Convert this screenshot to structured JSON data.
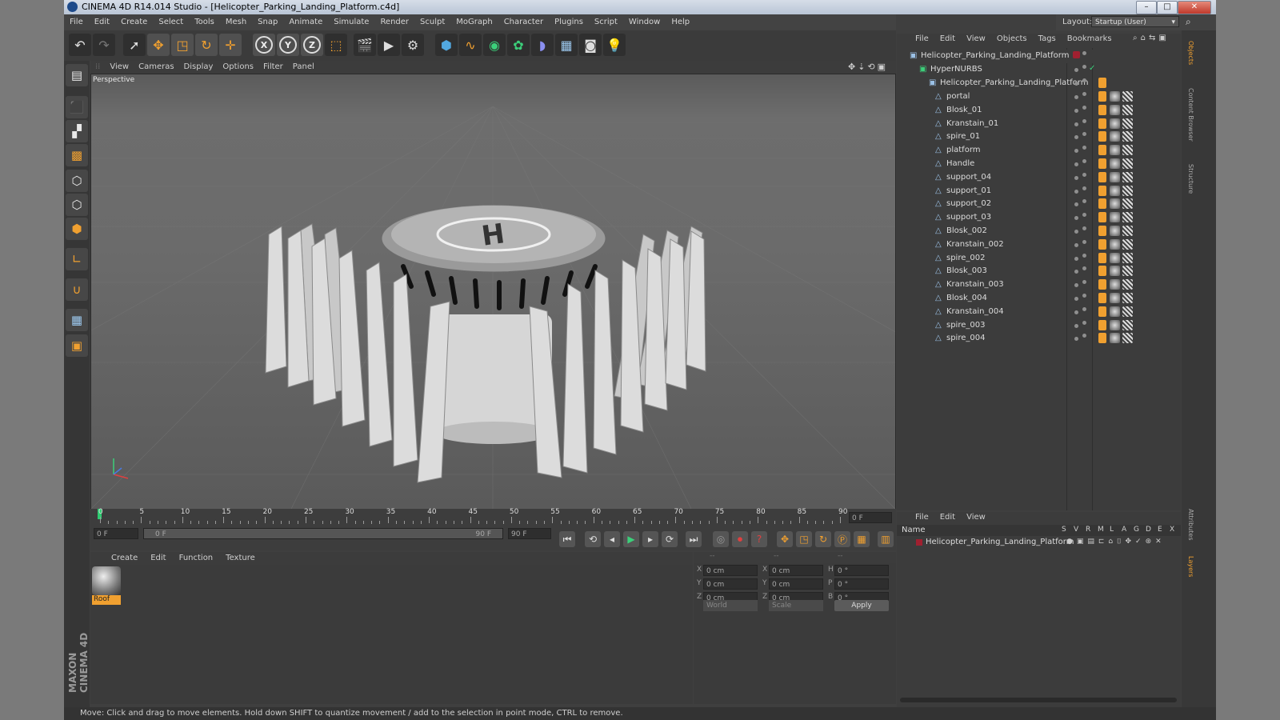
{
  "window": {
    "title": "CINEMA 4D R14.014 Studio - [Helicopter_Parking_Landing_Platform.c4d]",
    "controls": [
      "–",
      "□",
      "✕"
    ]
  },
  "menu": [
    "File",
    "Edit",
    "Create",
    "Select",
    "Tools",
    "Mesh",
    "Snap",
    "Animate",
    "Simulate",
    "Render",
    "Sculpt",
    "MoGraph",
    "Character",
    "Plugins",
    "Script",
    "Window",
    "Help"
  ],
  "layout": {
    "label": "Layout:",
    "value": "Startup (User)"
  },
  "toolbar": {
    "icons": [
      "undo-icon",
      "redo-icon",
      "select-arrow-icon",
      "move-icon",
      "scale-icon",
      "rotate-icon",
      "live-select-icon",
      "x-axis-icon",
      "y-axis-icon",
      "z-axis-icon",
      "coord-system-icon",
      "render-view-icon",
      "render-picture-icon",
      "render-settings-icon",
      "cube-icon",
      "spline-icon",
      "nurbs-icon",
      "array-icon",
      "deformer-icon",
      "floor-icon",
      "camera-icon",
      "light-icon"
    ],
    "axis_labels": [
      "X",
      "Y",
      "Z"
    ]
  },
  "viewport": {
    "menu": [
      "View",
      "Cameras",
      "Display",
      "Options",
      "Filter",
      "Panel"
    ],
    "label": "Perspective",
    "helipad_letter": "H"
  },
  "timeline": {
    "ticks": [
      "0",
      "5",
      "10",
      "15",
      "20",
      "25",
      "30",
      "35",
      "40",
      "45",
      "50",
      "55",
      "60",
      "65",
      "70",
      "75",
      "80",
      "85",
      "90"
    ],
    "current_frame": "0 F"
  },
  "transport": {
    "start": "0 F",
    "range_start": "0 F",
    "range_end": "90 F",
    "end": "90 F"
  },
  "materials": {
    "menu": [
      "Create",
      "Edit",
      "Function",
      "Texture"
    ],
    "items": [
      {
        "name": "Roof"
      }
    ]
  },
  "coords": {
    "header": [
      "--",
      "--",
      "--"
    ],
    "rows": [
      {
        "a": "X",
        "av": "0 cm",
        "b": "X",
        "bv": "0 cm",
        "c": "H",
        "cv": "0 °"
      },
      {
        "a": "Y",
        "av": "0 cm",
        "b": "Y",
        "bv": "0 cm",
        "c": "P",
        "cv": "0 °"
      },
      {
        "a": "Z",
        "av": "0 cm",
        "b": "Z",
        "bv": "0 cm",
        "c": "B",
        "cv": "0 °"
      }
    ],
    "world": "World",
    "scale": "Scale",
    "apply": "Apply"
  },
  "objects": {
    "menu": [
      "File",
      "Edit",
      "View",
      "Objects",
      "Tags",
      "Bookmarks"
    ],
    "root": "Helicopter_Parking_Landing_Platform",
    "hypernurbs": "HyperNURBS",
    "group": "Helicopter_Parking_Landing_Platform",
    "children": [
      "portal",
      "Blosk_01",
      "Kranstain_01",
      "spire_01",
      "platform",
      "Handle",
      "support_04",
      "support_01",
      "support_02",
      "support_03",
      "Blosk_002",
      "Kranstain_002",
      "spire_002",
      "Blosk_003",
      "Kranstain_003",
      "Blosk_004",
      "Kranstain_004",
      "spire_003",
      "spire_004"
    ]
  },
  "layers": {
    "menu": [
      "File",
      "Edit",
      "View"
    ],
    "columns": {
      "name": "Name",
      "flags": [
        "S",
        "V",
        "R",
        "M",
        "L",
        "A",
        "G",
        "D",
        "E",
        "X"
      ]
    },
    "rows": [
      {
        "name": "Helicopter_Parking_Landing_Platform"
      }
    ]
  },
  "side_tabs": [
    "Objects",
    "Content Browser",
    "Structure"
  ],
  "side_tabs_bottom": [
    "Attributes",
    "Layers"
  ],
  "branding": {
    "text": "MAXON CINEMA 4D"
  },
  "status": {
    "text": "Move: Click and drag to move elements. Hold down SHIFT to quantize movement / add to the selection in point mode, CTRL to remove."
  },
  "colors": {
    "accent": "#f0a030",
    "selection": "#3a6ea5",
    "timeline_marker": "#2ecc71"
  }
}
